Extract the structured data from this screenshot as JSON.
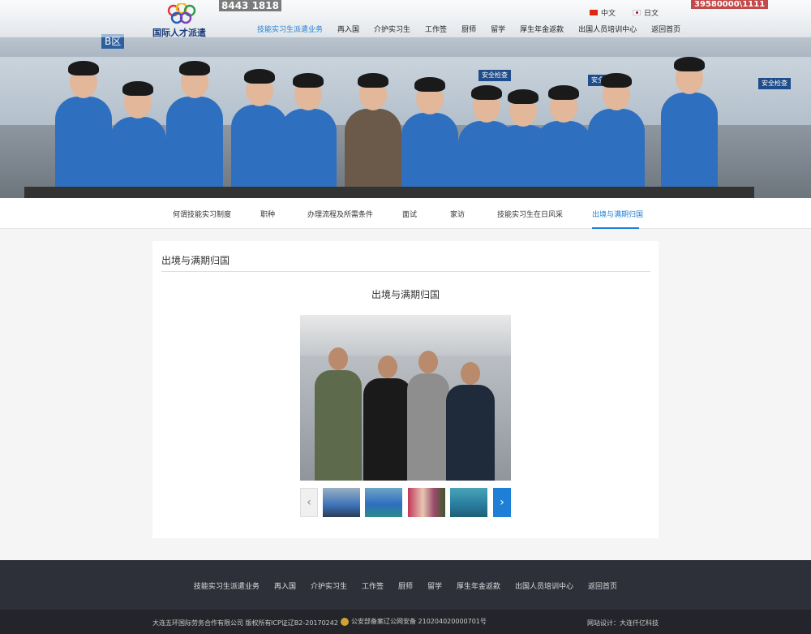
{
  "header": {
    "logo_text": "国际人才派遣",
    "phone_fragment": "8443 1818",
    "phone_fragment_right": "39580000\\1111",
    "lang": [
      {
        "label": "中文"
      },
      {
        "label": "日文"
      }
    ],
    "nav": [
      {
        "label": "技能实习生派遣业务",
        "active": true
      },
      {
        "label": "再入国"
      },
      {
        "label": "介护实习生"
      },
      {
        "label": "工作签"
      },
      {
        "label": "厨师"
      },
      {
        "label": "留学"
      },
      {
        "label": "厚生年金返款"
      },
      {
        "label": "出国人员培训中心"
      },
      {
        "label": "返回首页"
      }
    ]
  },
  "hero_signs": [
    "B区",
    "安全检查",
    "安全检查",
    "安全检查"
  ],
  "subnav": [
    {
      "label": "何谓技能实习制度"
    },
    {
      "label": "职种"
    },
    {
      "label": "办理流程及所需条件"
    },
    {
      "label": "面试"
    },
    {
      "label": "家访"
    },
    {
      "label": "技能实习生在日风采"
    },
    {
      "label": "出境与满期归国",
      "active": true
    }
  ],
  "content": {
    "section_title": "出境与满期归国",
    "article_title": "出境与满期归国",
    "prev_icon": "chevron-left-icon",
    "next_icon": "chevron-right-icon"
  },
  "footer": {
    "nav": [
      {
        "label": "技能实习生派遣业务"
      },
      {
        "label": "再入国"
      },
      {
        "label": "介护实习生"
      },
      {
        "label": "工作签"
      },
      {
        "label": "厨师"
      },
      {
        "label": "留学"
      },
      {
        "label": "厚生年金返款"
      },
      {
        "label": "出国人员培训中心"
      },
      {
        "label": "返回首页"
      }
    ],
    "copyright": "大连五环国际劳务合作有限公司 版权所有",
    "icp": "ICP证辽B2-20170242",
    "police": "公安部备案辽公网安备 210204020000701号",
    "design": "网站设计：大连仟亿科技"
  },
  "colors": {
    "accent": "#1f7fd6",
    "footer_bg": "#2d3038",
    "bottom_bg": "#23252b",
    "uniform_blue": "#2f6fc0"
  }
}
